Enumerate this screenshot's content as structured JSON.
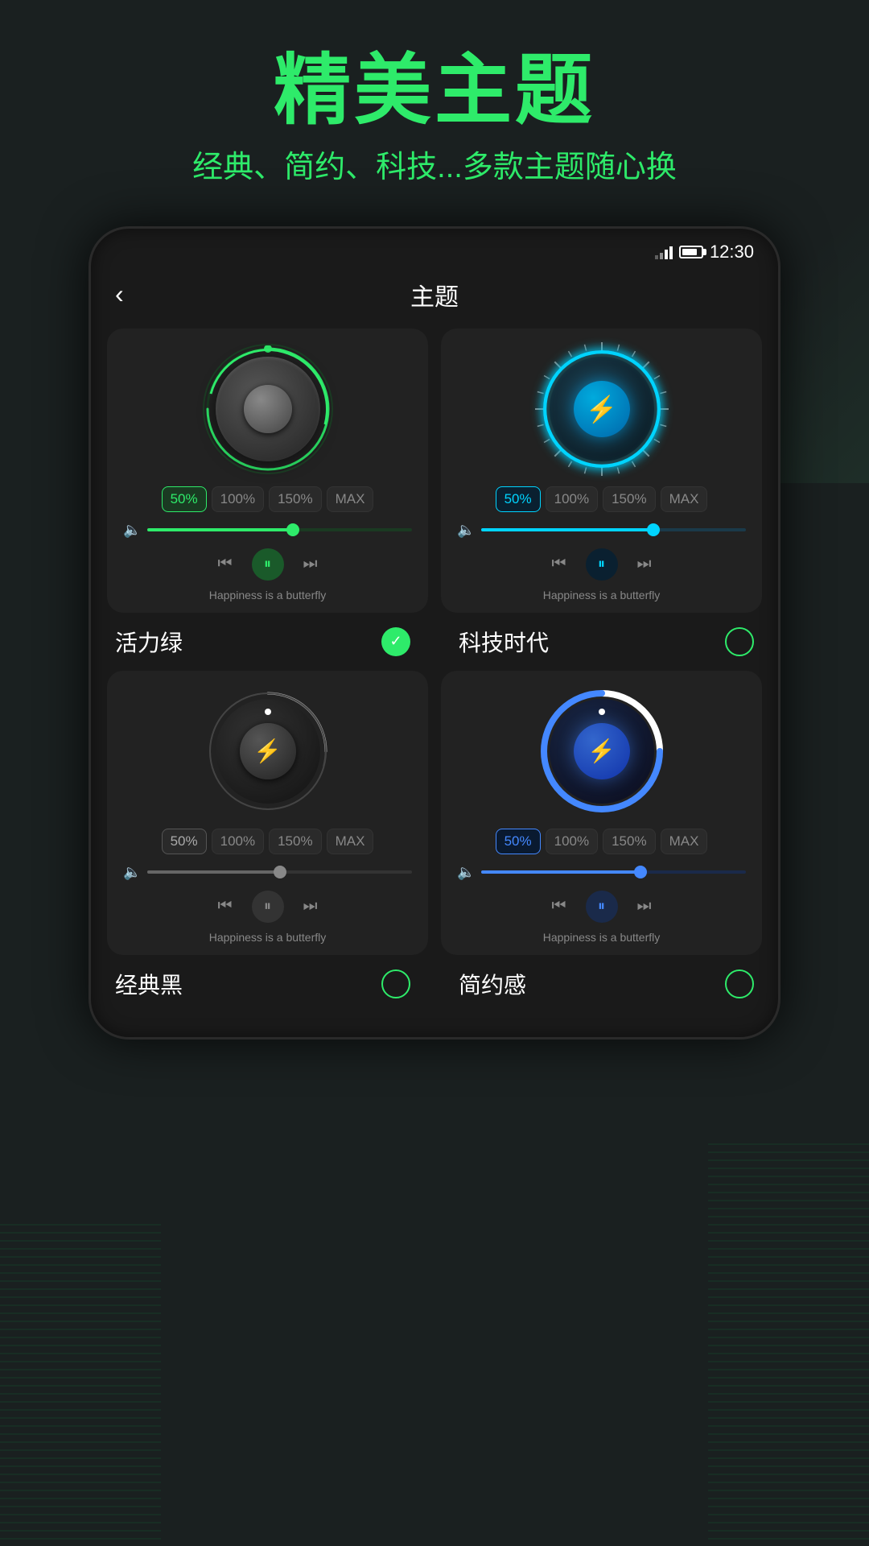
{
  "background": {
    "color": "#1a2020"
  },
  "header": {
    "title": "精美主题",
    "subtitle": "经典、简约、科技...多款主题随心换"
  },
  "statusBar": {
    "time": "12:30"
  },
  "topBar": {
    "backLabel": "‹",
    "pageTitle": "主题"
  },
  "themes": [
    {
      "id": "vitality-green",
      "label": "活力绿",
      "selected": true,
      "pctButtons": [
        "50%",
        "100%",
        "150%",
        "MAX"
      ],
      "activeIndex": 0,
      "songTitle": "Happiness is a butterfly",
      "sliderPos": 55
    },
    {
      "id": "tech-era",
      "label": "科技时代",
      "selected": false,
      "pctButtons": [
        "50%",
        "100%",
        "150%",
        "MAX"
      ],
      "activeIndex": 0,
      "songTitle": "Happiness is a butterfly",
      "sliderPos": 65
    },
    {
      "id": "classic-black",
      "label": "经典黑",
      "selected": false,
      "pctButtons": [
        "50%",
        "100%",
        "150%",
        "MAX"
      ],
      "activeIndex": 0,
      "songTitle": "Happiness is a butterfly",
      "sliderPos": 50
    },
    {
      "id": "minimalist",
      "label": "简约感",
      "selected": false,
      "pctButtons": [
        "50%",
        "100%",
        "150%",
        "MAX"
      ],
      "activeIndex": 0,
      "songTitle": "Happiness is a butterfly",
      "sliderPos": 60
    }
  ],
  "controls": {
    "prevLabel": "⏮",
    "pauseLabel": "⏸",
    "nextLabel": "⏭"
  }
}
